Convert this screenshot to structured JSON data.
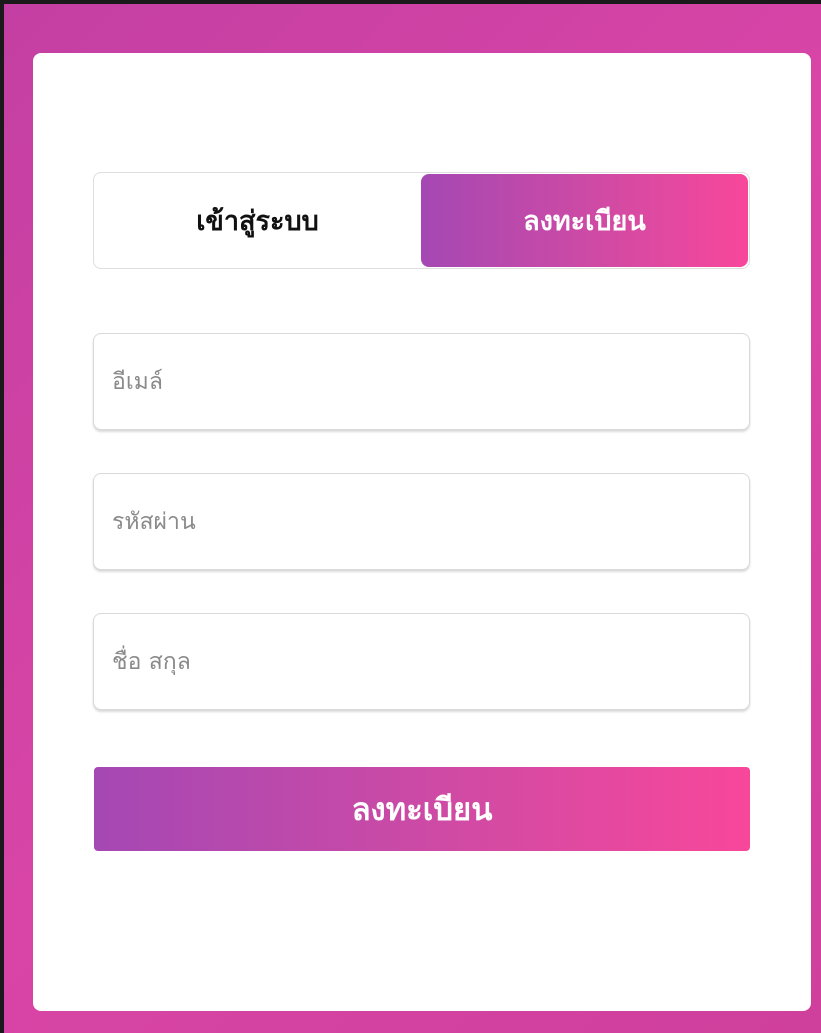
{
  "colors": {
    "background_gradient_start": "#c43fa3",
    "background_gradient_end": "#cf3f9c",
    "accent_gradient_start": "#a548b4",
    "accent_gradient_end": "#f8479b",
    "card": "#ffffff"
  },
  "auth_tabs": {
    "login_label": "เข้าสู่ระบบ",
    "register_label": "ลงทะเบียน",
    "active": "register"
  },
  "form": {
    "email_placeholder": "อีเมล์",
    "email_value": "",
    "password_placeholder": "รหัสผ่าน",
    "password_value": "",
    "fullname_placeholder": "ชื่อ สกุล",
    "fullname_value": "",
    "submit_label": "ลงทะเบียน"
  }
}
